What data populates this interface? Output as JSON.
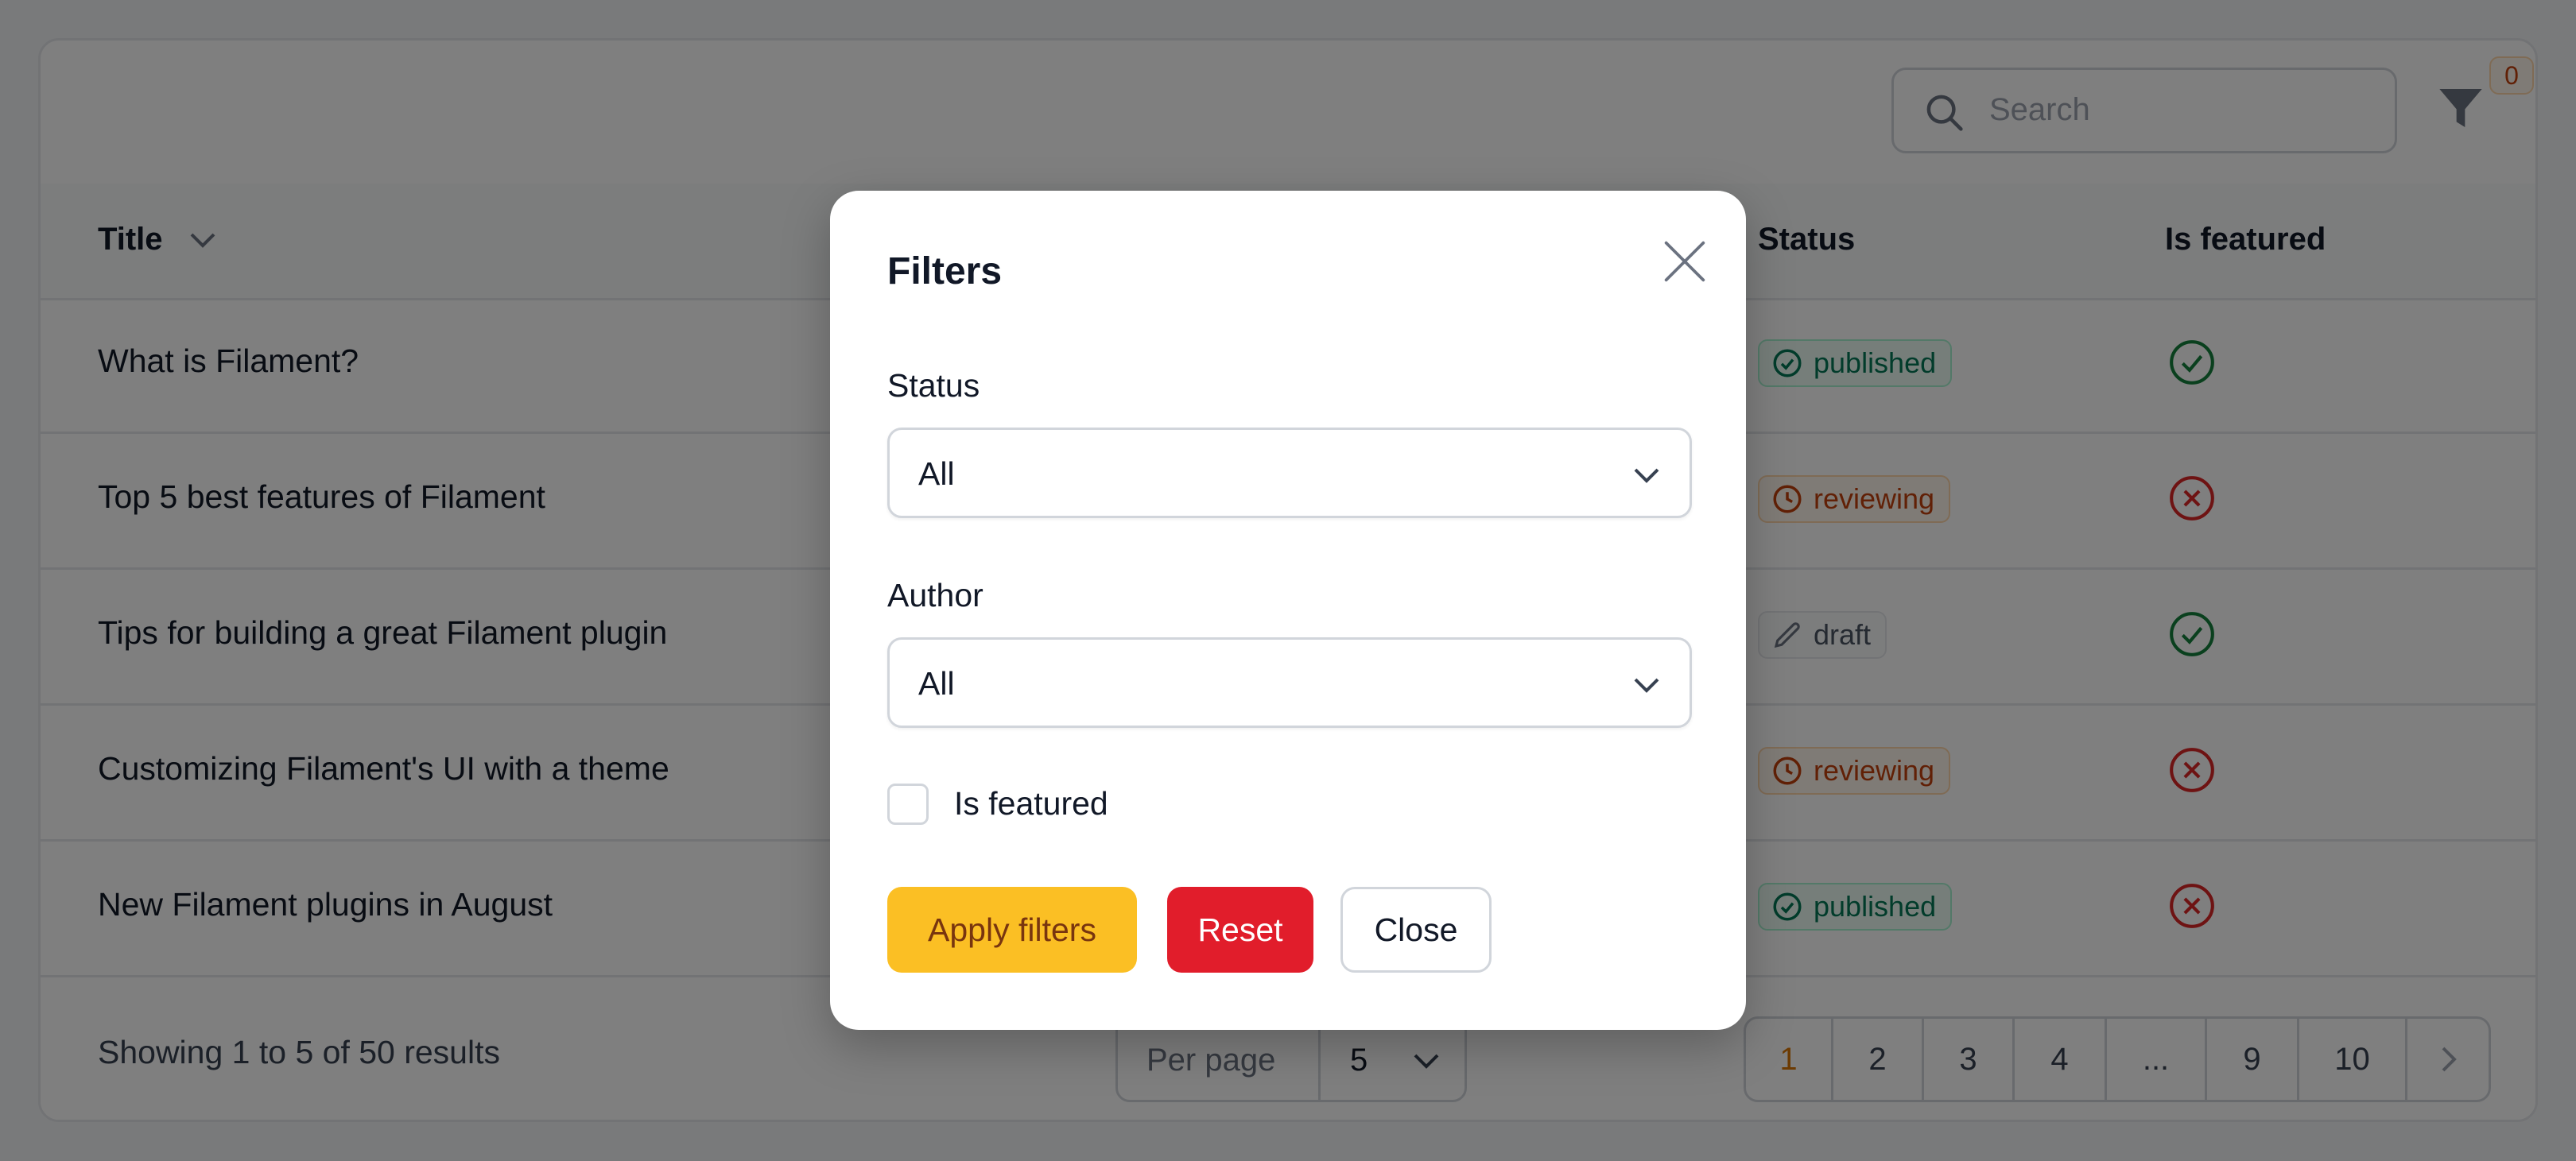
{
  "toolbar": {
    "search_placeholder": "Search",
    "filter_count": "0"
  },
  "table": {
    "columns": {
      "title": "Title",
      "status": "Status",
      "featured": "Is featured"
    },
    "rows": [
      {
        "title": "What is Filament?",
        "status": "published",
        "featured": true
      },
      {
        "title": "Top 5 best features of Filament",
        "status": "reviewing",
        "featured": false
      },
      {
        "title": "Tips for building a great Filament plugin",
        "status": "draft",
        "featured": true
      },
      {
        "title": "Customizing Filament's UI with a theme",
        "status": "reviewing",
        "featured": false
      },
      {
        "title": "New Filament plugins in August",
        "status": "published",
        "featured": false
      }
    ]
  },
  "footer": {
    "showing": "Showing 1 to 5 of 50 results",
    "per_page_label": "Per page",
    "per_page_value": "5",
    "pages": [
      "1",
      "2",
      "3",
      "4",
      "...",
      "9",
      "10"
    ],
    "active_page": "1"
  },
  "modal": {
    "title": "Filters",
    "status_label": "Status",
    "status_value": "All",
    "author_label": "Author",
    "author_value": "All",
    "featured_label": "Is featured",
    "apply_label": "Apply filters",
    "reset_label": "Reset",
    "close_label": "Close"
  },
  "colors": {
    "primary": "#fbbf24",
    "danger": "#e11d2b",
    "success": "#15803d",
    "warning": "#c2410c"
  },
  "icons": [
    "search-icon",
    "filter-icon",
    "chevron-down-icon",
    "check-circle-icon",
    "x-circle-icon",
    "clock-icon",
    "pencil-icon",
    "close-icon",
    "chevron-right-icon"
  ]
}
